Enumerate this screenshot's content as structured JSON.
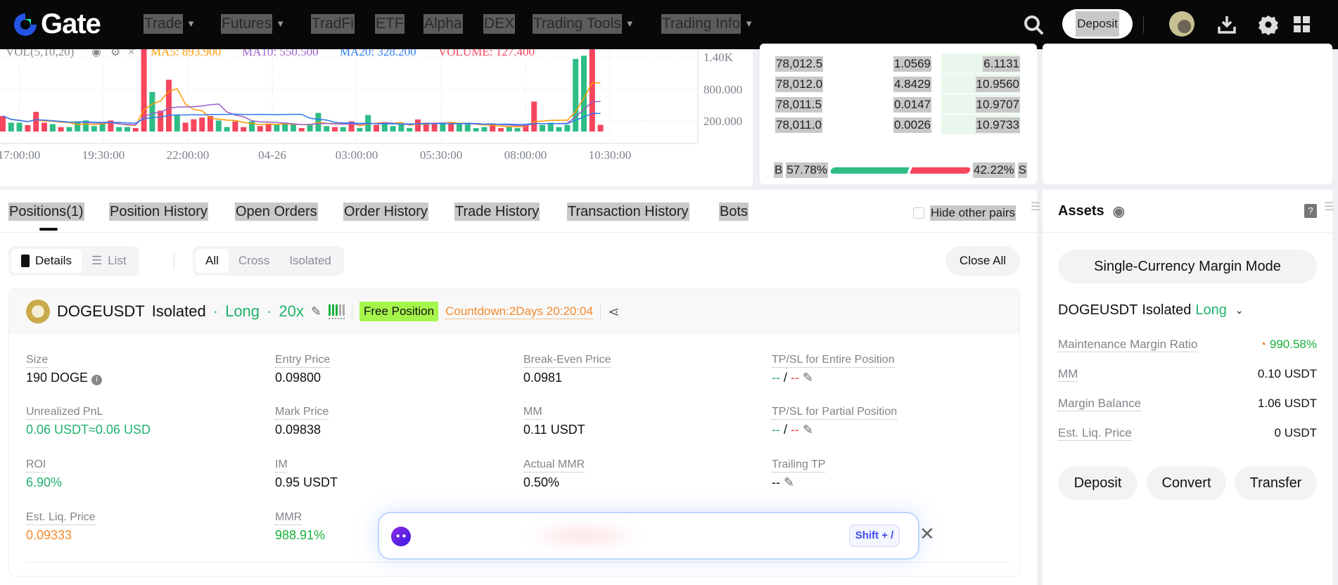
{
  "header": {
    "logo": "Gate",
    "nav": [
      {
        "label": "Trade",
        "dropdown": true
      },
      {
        "label": "Futures",
        "dropdown": true
      },
      {
        "label": "TradFi",
        "dropdown": false
      },
      {
        "label": "ETF",
        "dropdown": false
      },
      {
        "label": "Alpha",
        "dropdown": false
      },
      {
        "label": "DEX",
        "dropdown": false
      },
      {
        "label": "Trading Tools",
        "dropdown": true
      },
      {
        "label": "Trading Info",
        "dropdown": true
      }
    ],
    "deposit": "Deposit"
  },
  "chart": {
    "legend": {
      "name": "VOL(5,10,20)",
      "ma5": "MA5: 893.900",
      "ma10": "MA10: 550.500",
      "ma20": "MA20: 328.200",
      "volume": "VOLUME: 127.400"
    },
    "y_ticks": [
      "1.40K",
      "800.000",
      "200.000"
    ],
    "x_ticks": [
      "17:00:00",
      "19:30:00",
      "22:00:00",
      "04-26",
      "03:00:00",
      "05:30:00",
      "08:00:00",
      "10:30:00"
    ],
    "colors": {
      "up": "#2ebd85",
      "down": "#f6465d",
      "ma5": "#ff9800",
      "ma10": "#9c5ec8",
      "ma20": "#2f7bf0"
    },
    "volumes": [
      293,
      167,
      167,
      121,
      372,
      167,
      140,
      84,
      84,
      191,
      209,
      102,
      140,
      209,
      84,
      84,
      65,
      1609,
      749,
      395,
      981,
      312,
      167,
      232,
      265,
      293,
      209,
      84,
      191,
      84,
      191,
      102,
      140,
      140,
      167,
      140,
      65,
      126,
      353,
      102,
      84,
      84,
      191,
      65,
      312,
      126,
      167,
      102,
      140,
      65,
      228,
      167,
      167,
      140,
      167,
      140,
      167,
      65,
      84,
      140,
      65,
      102,
      65,
      126,
      567,
      126,
      167,
      84,
      126,
      1376,
      1437,
      1567,
      126
    ],
    "sides": [
      "d",
      "u",
      "u",
      "d",
      "d",
      "d",
      "u",
      "d",
      "u",
      "u",
      "u",
      "u",
      "u",
      "d",
      "u",
      "u",
      "d",
      "d",
      "u",
      "d",
      "d",
      "u",
      "d",
      "d",
      "d",
      "d",
      "u",
      "u",
      "d",
      "d",
      "u",
      "d",
      "d",
      "u",
      "u",
      "u",
      "d",
      "u",
      "u",
      "u",
      "d",
      "u",
      "d",
      "u",
      "u",
      "d",
      "u",
      "u",
      "u",
      "u",
      "d",
      "d",
      "d",
      "u",
      "d",
      "u",
      "u",
      "u",
      "u",
      "d",
      "d",
      "u",
      "u",
      "d",
      "d",
      "u",
      "u",
      "u",
      "u",
      "u",
      "u",
      "d",
      "d"
    ]
  },
  "orderbook": {
    "rows": [
      {
        "price": "78,012.5",
        "amount": "1.0569",
        "total": "6.1131",
        "depth": 0.55
      },
      {
        "price": "78,012.0",
        "amount": "4.8429",
        "total": "10.9560",
        "depth": 1
      },
      {
        "price": "78,011.5",
        "amount": "0.0147",
        "total": "10.9707",
        "depth": 1
      },
      {
        "price": "78,011.0",
        "amount": "0.0026",
        "total": "10.9733",
        "depth": 1
      }
    ],
    "buy_label": "B",
    "buy_pct": "57.78%",
    "sell_label": "S",
    "sell_pct": "42.22%",
    "buy_ratio": 57.78
  },
  "positions": {
    "tabs": [
      "Positions(1)",
      "Position History",
      "Open Orders",
      "Order History",
      "Trade History",
      "Transaction History",
      "Bots"
    ],
    "hide_other_pairs": "Hide other pairs",
    "view": {
      "details": "Details",
      "list": "List"
    },
    "filter": {
      "all": "All",
      "cross": "Cross",
      "isolated": "Isolated"
    },
    "close_all": "Close All",
    "card": {
      "symbol": "DOGEUSDT",
      "mode": "Isolated",
      "side": "Long",
      "leverage": "20x",
      "badge": "Free Position",
      "countdown": "Countdown:2Days 20:20:04",
      "fields": [
        {
          "label": "Size",
          "value": "190 DOGE",
          "cls": ""
        },
        {
          "label": "Entry Price",
          "value": "0.09800",
          "cls": ""
        },
        {
          "label": "Break-Even Price",
          "value": "0.0981",
          "cls": ""
        },
        {
          "label": "TP/SL for Entire Position",
          "value": "tpsl",
          "cls": ""
        },
        {
          "label": "Unrealized PnL",
          "value": "0.06 USDT≈0.06 USD",
          "cls": "g"
        },
        {
          "label": "Mark Price",
          "value": "0.09838",
          "cls": ""
        },
        {
          "label": "MM",
          "value": "0.11 USDT",
          "cls": ""
        },
        {
          "label": "TP/SL for Partial Position",
          "value": "tpsl",
          "cls": ""
        },
        {
          "label": "ROI",
          "value": "6.90%",
          "cls": "g"
        },
        {
          "label": "IM",
          "value": "0.95 USDT",
          "cls": ""
        },
        {
          "label": "Actual MMR",
          "value": "0.50%",
          "cls": ""
        },
        {
          "label": "Trailing TP",
          "value": "--",
          "cls": ""
        },
        {
          "label": "Est. Liq. Price",
          "value": "0.09333",
          "cls": "o"
        },
        {
          "label": "MMR",
          "value": "988.91%",
          "cls": "gg"
        }
      ],
      "tp": "--",
      "sl": "--"
    }
  },
  "assistant": {
    "shortcut": "Shift + /"
  },
  "assets": {
    "title": "Assets",
    "margin_mode": "Single-Currency Margin Mode",
    "position": {
      "symbol": "DOGEUSDT",
      "mode": "Isolated",
      "side": "Long"
    },
    "rows": [
      {
        "label": "Maintenance Margin Ratio",
        "value": "990.58%"
      },
      {
        "label": "MM",
        "value": "0.10 USDT"
      },
      {
        "label": "Margin Balance",
        "value": "1.06 USDT"
      },
      {
        "label": "Est. Liq. Price",
        "value": "0 USDT"
      }
    ],
    "buttons": [
      "Deposit",
      "Convert",
      "Transfer"
    ]
  }
}
